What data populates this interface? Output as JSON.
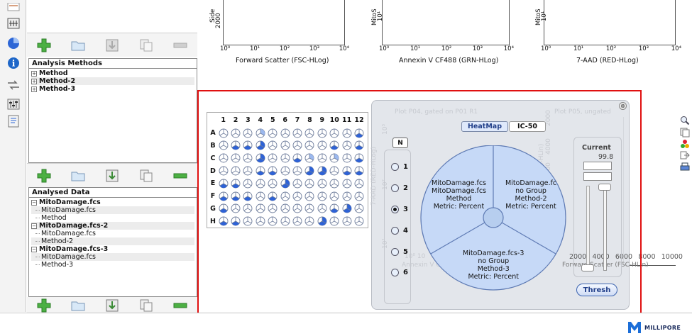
{
  "left_toolbar": {
    "icons": [
      "document-icon",
      "grid-icon",
      "pie-icon",
      "info-icon",
      "arrows-icon",
      "sliders-icon",
      "form-icon"
    ]
  },
  "panels": [
    {
      "title": "Analysis Methods",
      "items": [
        {
          "label": "Method",
          "expander": "+",
          "children": []
        },
        {
          "label": "Method-2",
          "expander": "+",
          "children": []
        },
        {
          "label": "Method-3",
          "expander": "+",
          "children": []
        }
      ]
    },
    {
      "title": "Analysed Data",
      "items": [
        {
          "label": "MitoDamage.fcs",
          "expander": "−",
          "children": [
            "MitoDamage.fcs",
            "Method"
          ]
        },
        {
          "label": "MitoDamage.fcs-2",
          "expander": "−",
          "children": [
            "MitoDamage.fcs",
            "Method-2"
          ]
        },
        {
          "label": "MitoDamage.fcs-3",
          "expander": "−",
          "children": [
            "MitoDamage.fcs",
            "Method-3"
          ]
        }
      ]
    }
  ],
  "graphs": [
    {
      "ylabel": "Side",
      "ytick": "2000",
      "xlabel": "Forward Scatter (FSC-HLog)",
      "xticks": [
        "10⁰",
        "10¹",
        "10²",
        "10³",
        "10⁴"
      ]
    },
    {
      "ylabel": "MitoS",
      "ytick": "10¹",
      "xlabel": "Annexin V CF488 (GRN-HLog)",
      "xticks": [
        "10⁰",
        "10¹",
        "10²",
        "10³",
        "10⁴"
      ]
    },
    {
      "ylabel": "MitoS",
      "ytick": "10¹",
      "xlabel": "7-AAD (RED-HLog)",
      "xticks": [
        "10⁰",
        "10¹",
        "10²",
        "10³",
        "10⁴"
      ]
    }
  ],
  "plate": {
    "columns": [
      "1",
      "2",
      "3",
      "4",
      "5",
      "6",
      "7",
      "8",
      "9",
      "10",
      "11",
      "12"
    ],
    "rows": [
      "A",
      "B",
      "C",
      "D",
      "E",
      "F",
      "G",
      "H"
    ],
    "wells": [
      [
        0,
        0,
        0,
        1,
        0,
        0,
        0,
        0,
        0,
        0,
        0,
        2
      ],
      [
        0,
        2,
        2,
        3,
        0,
        0,
        0,
        0,
        0,
        2,
        0,
        2
      ],
      [
        0,
        0,
        0,
        3,
        0,
        0,
        2,
        1,
        0,
        1,
        0,
        2
      ],
      [
        0,
        0,
        0,
        2,
        2,
        0,
        0,
        3,
        3,
        0,
        2,
        2
      ],
      [
        2,
        2,
        0,
        0,
        0,
        3,
        0,
        0,
        0,
        0,
        0,
        0
      ],
      [
        2,
        2,
        2,
        0,
        2,
        0,
        0,
        0,
        0,
        0,
        0,
        0
      ],
      [
        2,
        0,
        0,
        0,
        0,
        0,
        0,
        0,
        0,
        2,
        3,
        0
      ],
      [
        2,
        2,
        0,
        0,
        0,
        0,
        0,
        0,
        3,
        0,
        0,
        0
      ]
    ]
  },
  "dialog": {
    "tabs": {
      "heatmap": "HeatMap",
      "ic50": "IC-50"
    },
    "n_label": "N",
    "radios": [
      "1",
      "2",
      "3",
      "4",
      "5",
      "6"
    ],
    "selected_radio": "3",
    "background_text": {
      "plot_left": "Plot P04, gated on P01 R1",
      "plot_right": "Plot P05, ungated",
      "axis_left_y": "7-AAD (RED-HLog)",
      "axis_left_x": "Annexin V C",
      "axis_right_y": "(FSC-HLin)",
      "axis_right_x": "Forward Scatter (FSC-HLin)",
      "ticks_right": [
        "2000",
        "4000",
        "6000",
        "8000",
        "10000"
      ],
      "ticks_right_y": [
        "2000",
        "4000",
        "6000",
        "8000"
      ],
      "ticks_left_y": [
        "10³",
        "10²",
        "10¹"
      ],
      "ticks_left_x": "10⁰ 10"
    },
    "pie_segments": [
      {
        "lines": [
          "MitoDamage.fcs",
          "MitoDamage.fcs",
          "Method",
          "Metric: Percent"
        ]
      },
      {
        "lines": [
          "MitoDamage.fc",
          "no Group",
          "Method-2",
          "Metric: Percent"
        ]
      },
      {
        "lines": [
          "MitoDamage.fcs-3",
          "no Group",
          "Method-3",
          "Metric: Percent"
        ]
      }
    ],
    "current_label": "Current",
    "current_value": "99.8",
    "thresh_label": "Thresh",
    "close_glyph": "⊗"
  },
  "right_icons": [
    "zoom-icon",
    "copy-icon",
    "color-dots-icon",
    "export-icon",
    "print-icon"
  ],
  "brand": {
    "name": "MILLIPORE"
  },
  "colors": {
    "selection": "#e01010",
    "pie_fill": "#c6d9f7",
    "well_blue": "#2e62d6",
    "light_blue": "#9bb8ee"
  }
}
